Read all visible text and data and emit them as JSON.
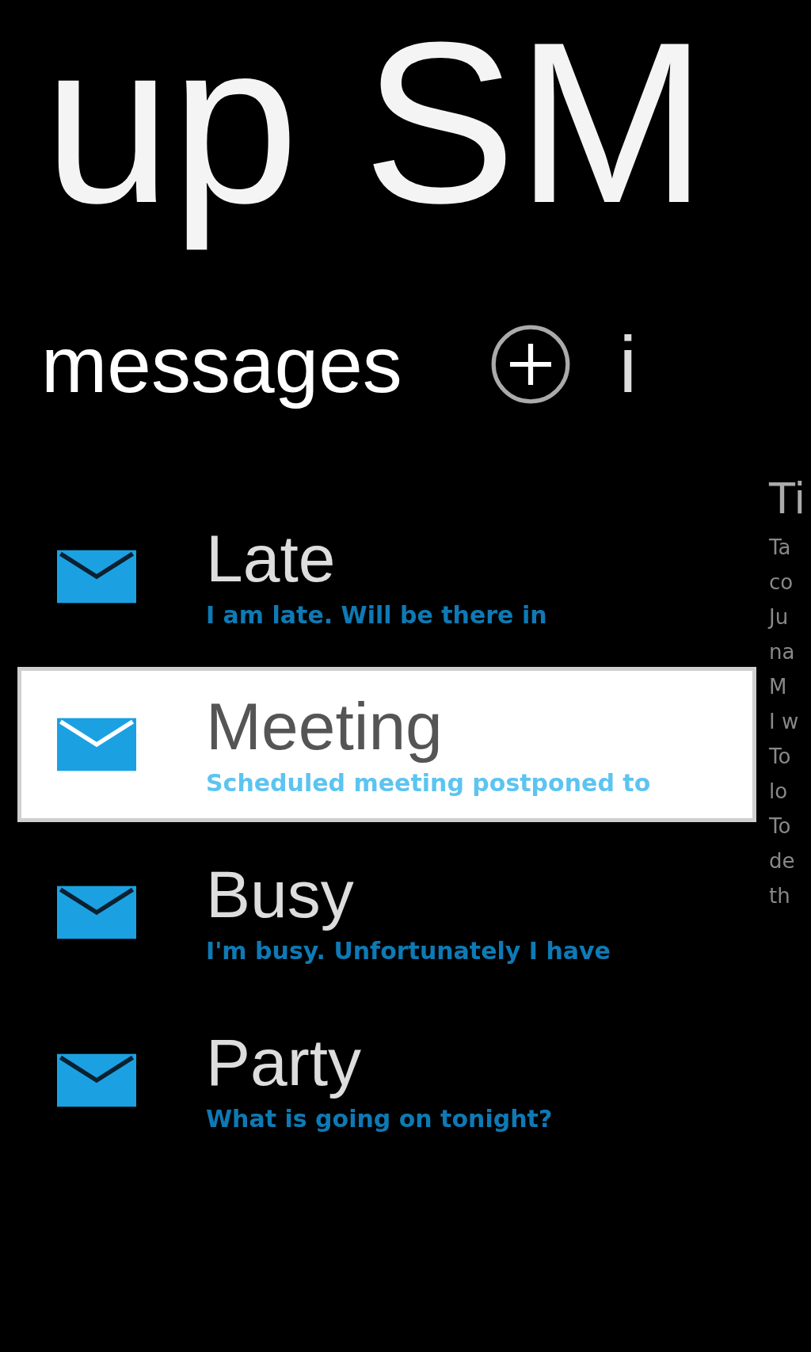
{
  "title": "up SM",
  "section": {
    "header": "messages",
    "next_header": "i"
  },
  "messages": [
    {
      "title": "Late",
      "preview": "I am late. Will be there in",
      "selected": false
    },
    {
      "title": "Meeting",
      "preview": "Scheduled meeting postponed to",
      "selected": true
    },
    {
      "title": "Busy",
      "preview": "I'm busy. Unfortunately I have",
      "selected": false
    },
    {
      "title": "Party",
      "preview": "What is going on tonight?",
      "selected": false
    }
  ],
  "side_panel": {
    "heading": "Ti",
    "lines": [
      "Ta",
      "co",
      "Ju",
      "na",
      "M",
      "I w",
      "To",
      "lo",
      "To",
      "de",
      "th"
    ]
  }
}
